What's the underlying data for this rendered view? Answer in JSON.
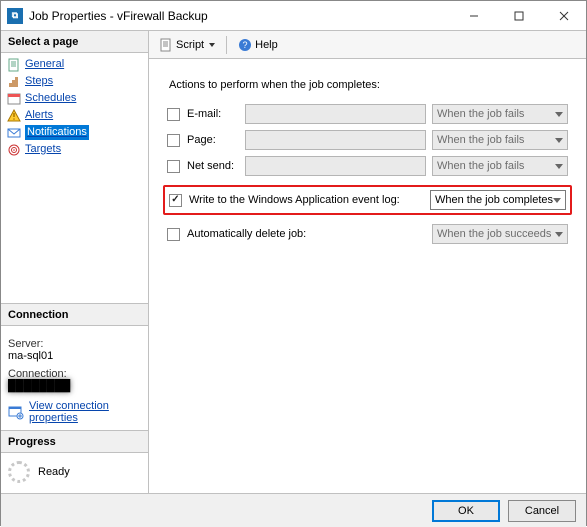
{
  "window": {
    "title": "Job Properties - vFirewall Backup"
  },
  "left": {
    "select_page_header": "Select a page",
    "pages": [
      {
        "label": "General",
        "icon": "page-icon"
      },
      {
        "label": "Steps",
        "icon": "steps-icon"
      },
      {
        "label": "Schedules",
        "icon": "schedule-icon"
      },
      {
        "label": "Alerts",
        "icon": "alert-icon"
      },
      {
        "label": "Notifications",
        "icon": "notify-icon",
        "selected": true
      },
      {
        "label": "Targets",
        "icon": "target-icon"
      }
    ],
    "connection_header": "Connection",
    "server_label": "Server:",
    "server_value": "ma-sql01",
    "connection_label": "Connection:",
    "connection_value": "████████",
    "view_props_link": "View connection properties",
    "progress_header": "Progress",
    "progress_status": "Ready"
  },
  "toolbar": {
    "script_label": "Script",
    "help_label": "Help"
  },
  "form": {
    "title": "Actions to perform when the job completes:",
    "rows": {
      "email": {
        "label": "E-mail:",
        "when": "When the job fails"
      },
      "page": {
        "label": "Page:",
        "when": "When the job fails"
      },
      "netsend": {
        "label": "Net send:",
        "when": "When the job fails"
      },
      "eventlog": {
        "label": "Write to the Windows Application event log:",
        "checked": true,
        "when": "When the job completes"
      },
      "autodel": {
        "label": "Automatically delete job:",
        "when": "When the job succeeds"
      }
    }
  },
  "footer": {
    "ok": "OK",
    "cancel": "Cancel"
  }
}
